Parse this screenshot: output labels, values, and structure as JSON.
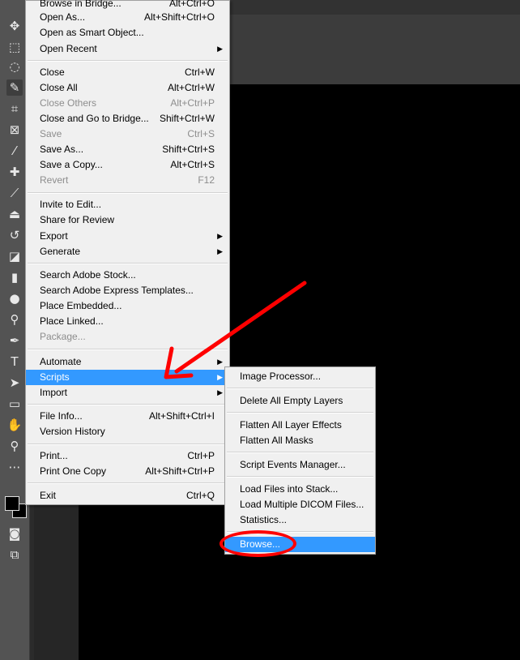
{
  "file_menu": {
    "items": [
      {
        "label": "Browse in Bridge...",
        "shortcut": "Alt+Ctrl+O"
      },
      {
        "label": "Open As...",
        "shortcut": "Alt+Shift+Ctrl+O"
      },
      {
        "label": "Open as Smart Object...",
        "shortcut": ""
      },
      {
        "label": "Open Recent",
        "shortcut": ""
      },
      {
        "label": "Close",
        "shortcut": "Ctrl+W"
      },
      {
        "label": "Close All",
        "shortcut": "Alt+Ctrl+W"
      },
      {
        "label": "Close Others",
        "shortcut": "Alt+Ctrl+P"
      },
      {
        "label": "Close and Go to Bridge...",
        "shortcut": "Shift+Ctrl+W"
      },
      {
        "label": "Save",
        "shortcut": "Ctrl+S"
      },
      {
        "label": "Save As...",
        "shortcut": "Shift+Ctrl+S"
      },
      {
        "label": "Save a Copy...",
        "shortcut": "Alt+Ctrl+S"
      },
      {
        "label": "Revert",
        "shortcut": "F12"
      },
      {
        "label": "Invite to Edit...",
        "shortcut": ""
      },
      {
        "label": "Share for Review",
        "shortcut": ""
      },
      {
        "label": "Export",
        "shortcut": ""
      },
      {
        "label": "Generate",
        "shortcut": ""
      },
      {
        "label": "Search Adobe Stock...",
        "shortcut": ""
      },
      {
        "label": "Search Adobe Express Templates...",
        "shortcut": ""
      },
      {
        "label": "Place Embedded...",
        "shortcut": ""
      },
      {
        "label": "Place Linked...",
        "shortcut": ""
      },
      {
        "label": "Package...",
        "shortcut": ""
      },
      {
        "label": "Automate",
        "shortcut": ""
      },
      {
        "label": "Scripts",
        "shortcut": ""
      },
      {
        "label": "Import",
        "shortcut": ""
      },
      {
        "label": "File Info...",
        "shortcut": "Alt+Shift+Ctrl+I"
      },
      {
        "label": "Version History",
        "shortcut": ""
      },
      {
        "label": "Print...",
        "shortcut": "Ctrl+P"
      },
      {
        "label": "Print One Copy",
        "shortcut": "Alt+Shift+Ctrl+P"
      },
      {
        "label": "Exit",
        "shortcut": "Ctrl+Q"
      }
    ]
  },
  "scripts_submenu": {
    "items": [
      {
        "label": "Image Processor..."
      },
      {
        "label": "Delete All Empty Layers"
      },
      {
        "label": "Flatten All Layer Effects"
      },
      {
        "label": "Flatten All Masks"
      },
      {
        "label": "Script Events Manager..."
      },
      {
        "label": "Load Files into Stack..."
      },
      {
        "label": "Load Multiple DICOM Files..."
      },
      {
        "label": "Statistics..."
      },
      {
        "label": "Browse..."
      }
    ]
  },
  "toolbar": {
    "tools": [
      "move-icon",
      "marquee-icon",
      "lasso-icon",
      "quick-select-icon",
      "crop-icon",
      "frame-icon",
      "eyedropper-icon",
      "healing-icon",
      "brush-icon",
      "stamp-icon",
      "history-brush-icon",
      "eraser-icon",
      "gradient-icon",
      "blur-icon",
      "dodge-icon",
      "pen-icon",
      "type-icon",
      "path-select-icon",
      "rectangle-icon",
      "hand-icon",
      "zoom-icon",
      "more-icon",
      "quick-mask-icon",
      "screen-mode-icon"
    ]
  },
  "colors": {
    "highlight": "#3399ff",
    "menu_bg": "#f0f0f0",
    "annotation": "#ff0000"
  }
}
